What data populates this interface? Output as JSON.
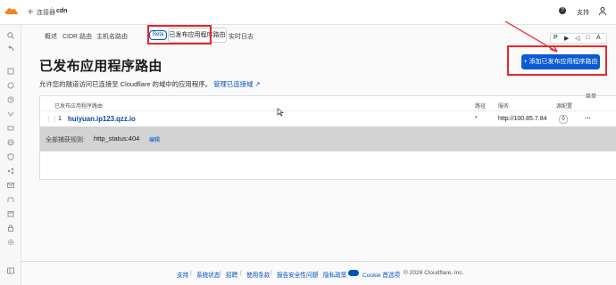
{
  "topbar": {
    "breadcrumb": [
      "连接器",
      "cdn"
    ],
    "crumb_sep": "/",
    "support_label": "支持",
    "support_icon": "?"
  },
  "tabs": [
    {
      "label": "概述"
    },
    {
      "label": "CIDR 路由"
    },
    {
      "label": "主机名路由"
    },
    {
      "label": "已发布应用程序路由",
      "active": true
    },
    {
      "label": "实时日志"
    }
  ],
  "beta_label": "Beta",
  "page": {
    "title": "已发布应用程序路由",
    "description": "允许您的隧道访问已连接至 Cloudflare 的域中的应用程序。",
    "manage_link": "管理已连接域",
    "manage_link_icon": "↗",
    "add_button": "+ 添加已发布应用程序路由"
  },
  "float_toolbar": {
    "items": [
      "P",
      "▶",
      "◁",
      "□",
      "A"
    ]
  },
  "table": {
    "headers": {
      "hostname": "已发布应用程序路由",
      "path": "路径",
      "service": "服务",
      "origin": "源配置",
      "menu": "菜单"
    },
    "rows": [
      {
        "index": "1",
        "hostname": "huiyuan.ip123.qzz.io",
        "path": "*",
        "service": "http://100.85.7.84",
        "origin_count": "0",
        "more": "···"
      }
    ],
    "drag_handle": "⋮⋮",
    "catchall": {
      "label": "全部捕获规则:",
      "value": "http_status:404",
      "edit": "编辑"
    }
  },
  "footer": {
    "links": [
      "支持",
      "系统状态",
      "招聘",
      "使用条款",
      "报告安全性问题",
      "隐私政策",
      "Cookie 首选项"
    ],
    "separator": "|",
    "copyright": "© 2026 Cloudflare, Inc."
  },
  "colors": {
    "accent": "#0051c3",
    "button": "#0a5ad3",
    "highlight": "#e8262a"
  }
}
